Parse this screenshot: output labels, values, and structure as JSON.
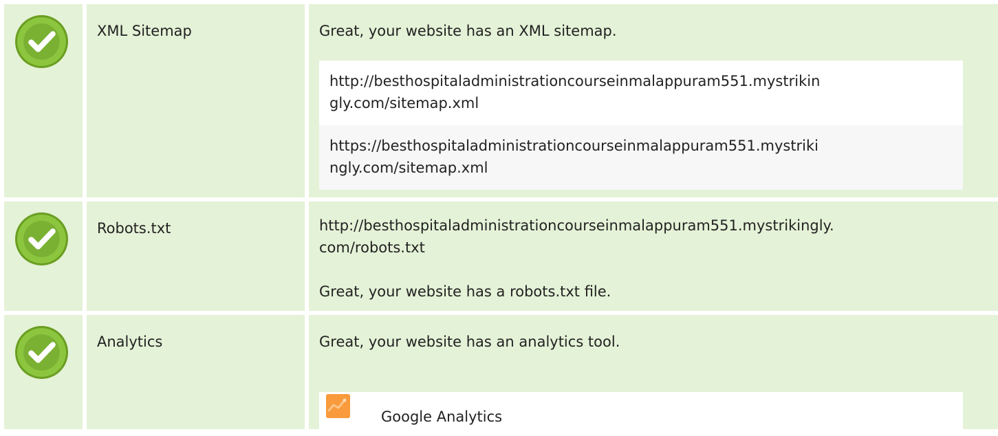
{
  "rows": {
    "sitemap": {
      "name": "XML Sitemap",
      "message": "Great, your website has an XML sitemap.",
      "urls": [
        "http://besthospitaladministrationcourseinmalappuram551.mystrikin\ngly.com/sitemap.xml",
        "https://besthospitaladministrationcourseinmalappuram551.mystriki\nngly.com/sitemap.xml"
      ]
    },
    "robots": {
      "name": "Robots.txt",
      "url": "http://besthospitaladministrationcourseinmalappuram551.mystrikingly.\ncom/robots.txt",
      "message": "Great, your website has a robots.txt file."
    },
    "analytics": {
      "name": "Analytics",
      "message": "Great, your website has an analytics tool.",
      "tool": "Google Analytics"
    }
  },
  "colors": {
    "cell_bg": "#e4f2d7",
    "check_green": "#8cc63f",
    "ga_orange": "#f99b3c"
  },
  "icons": {
    "check": "check-circle-icon",
    "ga": "google-analytics-icon"
  }
}
